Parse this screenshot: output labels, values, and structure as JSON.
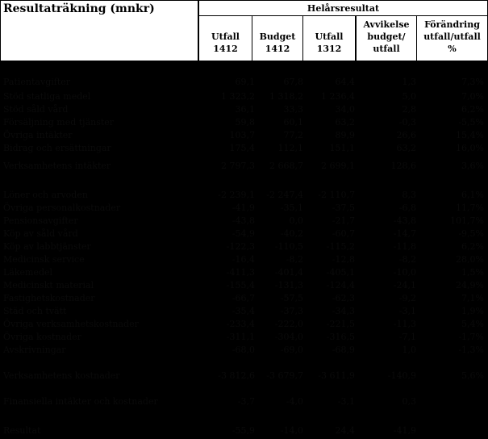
{
  "header": {
    "title": "Resultaträkning (mnkr)",
    "group": "Helårsresultat",
    "columns": [
      {
        "l1": "",
        "l2": "Utfall",
        "l3": "1412"
      },
      {
        "l1": "",
        "l2": "Budget",
        "l3": "1412"
      },
      {
        "l1": "",
        "l2": "Utfall",
        "l3": "1312"
      },
      {
        "l1": "Avvikelse",
        "l2": "budget/",
        "l3": "utfall"
      },
      {
        "l1": "Förändring",
        "l2": "utfall/utfall",
        "l3": "%"
      }
    ]
  },
  "rows": [
    {
      "label": "Patientavgifter",
      "values": [
        "69,1",
        "67,8",
        "64,4",
        "1,3",
        "7,3%"
      ]
    },
    {
      "label": "Stöd statliga medel",
      "values": [
        "1 323,2",
        "1 318,2",
        "1 236,4",
        "5,0",
        "7,0%"
      ]
    },
    {
      "label": "Stöd såld vård",
      "values": [
        "36,1",
        "33,3",
        "34,0",
        "2,8",
        "6,2%"
      ]
    },
    {
      "label": "Försäljning med tjänster",
      "values": [
        "59,8",
        "60,1",
        "63,2",
        "-0,3",
        "-5,5%"
      ]
    },
    {
      "label": "Övriga intäkter",
      "values": [
        "103,7",
        "77,2",
        "89,9",
        "26,6",
        "15,4%"
      ]
    },
    {
      "label": "Bidrag och ersättningar",
      "values": [
        "175,4",
        "112,1",
        "151,1",
        "63,2",
        "16,0%"
      ]
    },
    {
      "label": "Verksamhetens intäkter",
      "values": [
        "2 797,3",
        "2 668,7",
        "2 699,1",
        "128,6",
        "3,6%"
      ]
    },
    {
      "label": "Löner och arvoden",
      "values": [
        "-2 239,1",
        "-2 247,4",
        "-2 110,7",
        "8,3",
        "6,1%"
      ]
    },
    {
      "label": "Övriga personalkostnader",
      "values": [
        "-41,9",
        "-35,1",
        "-37,5",
        "-6,8",
        "11,7%"
      ]
    },
    {
      "label": "Pensionsavgifter",
      "values": [
        "-43,8",
        "0,0",
        "-21,7",
        "-43,8",
        "101,7%"
      ]
    },
    {
      "label": "Köp av såld vård",
      "values": [
        "-54,9",
        "-40,2",
        "-60,7",
        "-14,7",
        "-9,5%"
      ]
    },
    {
      "label": "Köp av labbtjänster",
      "values": [
        "-122,3",
        "-110,5",
        "-115,2",
        "-11,8",
        "6,2%"
      ]
    },
    {
      "label": "Medicinsk service",
      "values": [
        "-16,4",
        "-8,2",
        "-12,8",
        "-8,2",
        "28,0%"
      ]
    },
    {
      "label": "Läkemedel",
      "values": [
        "-411,3",
        "-401,4",
        "-405,1",
        "-10,0",
        "1,5%"
      ]
    },
    {
      "label": "Medicinskt material",
      "values": [
        "-155,4",
        "-131,3",
        "-124,4",
        "-24,1",
        "24,9%"
      ]
    },
    {
      "label": "Fastighetskostnader",
      "values": [
        "-66,7",
        "-57,5",
        "-62,3",
        "-9,2",
        "7,1%"
      ]
    },
    {
      "label": "Städ och tvätt",
      "values": [
        "-35,4",
        "-37,3",
        "-34,3",
        "-3,1",
        "1,9%"
      ]
    },
    {
      "label": "Övriga verksamhetskostnader",
      "values": [
        "-233,4",
        "-222,0",
        "-221,5",
        "-11,3",
        "5,4%"
      ]
    },
    {
      "label": "Övriga kostnader",
      "values": [
        "-311,1",
        "-304,0",
        "-316,5",
        "-7,1",
        "-1,7%"
      ]
    },
    {
      "label": "Avskrivningar",
      "values": [
        "-68,0",
        "-69,0",
        "-68,9",
        "1,0",
        "-1,3%"
      ]
    },
    {
      "label": "Verksamhetens kostnader",
      "values": [
        "-3 812,6",
        "-3 679,7",
        "-3 611,9",
        "-140,9",
        "5,6%"
      ]
    },
    {
      "label": "Finansiella intäkter och kostnader",
      "values": [
        "-3,7",
        "-4,0",
        "-3,1",
        "0,3",
        ""
      ]
    },
    {
      "label": "Resultat",
      "values": [
        "-55,9",
        "-14,0",
        "24,4",
        "-41,9",
        ""
      ]
    }
  ]
}
